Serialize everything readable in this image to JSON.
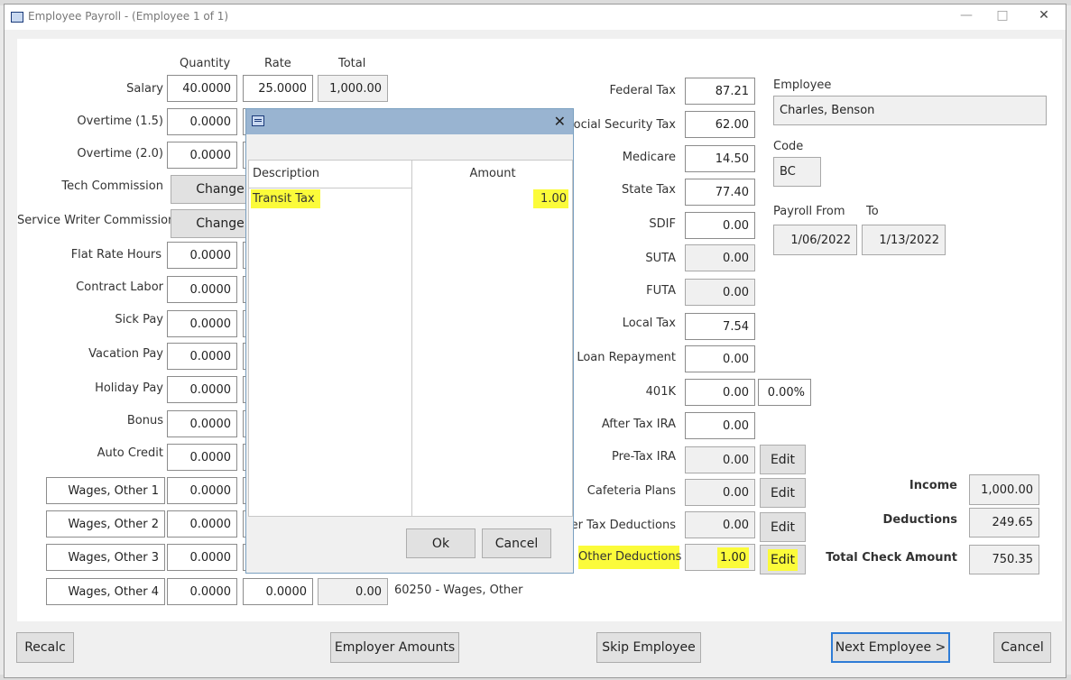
{
  "window": {
    "title": "Employee Payroll - (Employee 1 of 1)"
  },
  "earnings": {
    "headers": {
      "quantity": "Quantity",
      "rate": "Rate",
      "total": "Total"
    },
    "salary": {
      "label": "Salary",
      "quantity": "40.0000",
      "rate": "25.0000",
      "total": "1,000.00"
    },
    "overtime15": {
      "label": "Overtime (1.5)",
      "quantity": "0.0000"
    },
    "overtime20": {
      "label": "Overtime (2.0)",
      "quantity": "0.0000"
    },
    "tech_commission": {
      "label": "Tech Commission",
      "button": "Change"
    },
    "service_writer_commission": {
      "label": "Service Writer Commission",
      "button": "Change"
    },
    "flat_rate_hours": {
      "label": "Flat Rate Hours",
      "quantity": "0.0000"
    },
    "contract_labor": {
      "label": "Contract Labor",
      "quantity": "0.0000"
    },
    "sick_pay": {
      "label": "Sick Pay",
      "quantity": "0.0000"
    },
    "vacation_pay": {
      "label": "Vacation Pay",
      "quantity": "0.0000"
    },
    "holiday_pay": {
      "label": "Holiday Pay",
      "quantity": "0.0000"
    },
    "bonus": {
      "label": "Bonus",
      "quantity": "0.0000"
    },
    "auto_credit": {
      "label": "Auto Credit",
      "quantity": "0.0000"
    },
    "wages_other_1": {
      "label": "Wages, Other 1",
      "quantity": "0.0000"
    },
    "wages_other_2": {
      "label": "Wages, Other 2",
      "quantity": "0.0000"
    },
    "wages_other_3": {
      "label": "Wages, Other 3",
      "quantity": "0.0000"
    },
    "wages_other_4": {
      "label": "Wages, Other 4",
      "quantity": "0.0000",
      "rate": "0.0000",
      "total": "0.00",
      "account": "60250 - Wages, Other"
    }
  },
  "taxes": {
    "federal_tax": {
      "label": "Federal Tax",
      "value": "87.21"
    },
    "social_security_tax": {
      "label": "Social Security Tax",
      "value": "62.00"
    },
    "medicare": {
      "label": "Medicare",
      "value": "14.50"
    },
    "state_tax": {
      "label": "State Tax",
      "value": "77.40"
    },
    "sdif": {
      "label": "SDIF",
      "value": "0.00"
    },
    "suta": {
      "label": "SUTA",
      "value": "0.00"
    },
    "futa": {
      "label": "FUTA",
      "value": "0.00"
    },
    "local_tax": {
      "label": "Local Tax",
      "value": "7.54"
    },
    "loan_repayment": {
      "label": "Loan Repayment",
      "value": "0.00"
    },
    "k401": {
      "label": "401K",
      "value": "0.00",
      "percent": "0.00%"
    },
    "after_tax_ira": {
      "label": "After Tax IRA",
      "value": "0.00"
    },
    "pre_tax_ira": {
      "label": "Pre-Tax IRA",
      "value": "0.00",
      "button": "Edit"
    },
    "cafeteria_plans": {
      "label": "Cafeteria Plans",
      "value": "0.00",
      "button": "Edit"
    },
    "after_tax_deductions": {
      "label": "After Tax Deductions",
      "value": "0.00",
      "button": "Edit"
    },
    "other_deductions": {
      "label": "Other Deductions",
      "value": "1.00",
      "button": "Edit"
    }
  },
  "employee": {
    "label": "Employee",
    "name": "Charles, Benson",
    "code_label": "Code",
    "code": "BC",
    "payroll_from_label": "Payroll From",
    "to_label": "To",
    "from": "1/06/2022",
    "to": "1/13/2022"
  },
  "summary": {
    "income_label": "Income",
    "income": "1,000.00",
    "deductions_label": "Deductions",
    "deductions": "249.65",
    "total_check_label": "Total Check Amount",
    "total_check": "750.35"
  },
  "dialog": {
    "headers": {
      "description": "Description",
      "amount": "Amount"
    },
    "rows": [
      {
        "description": "Transit Tax",
        "amount": "1.00"
      }
    ],
    "ok": "Ok",
    "cancel": "Cancel"
  },
  "footer": {
    "recalc": "Recalc",
    "employer_amounts": "Employer Amounts",
    "skip_employee": "Skip Employee",
    "next_employee": "Next Employee >",
    "cancel": "Cancel"
  },
  "colors": {
    "highlight": "#fbfb3a",
    "accent": "#2e7cd6",
    "dialog_title": "#99b4d1"
  }
}
